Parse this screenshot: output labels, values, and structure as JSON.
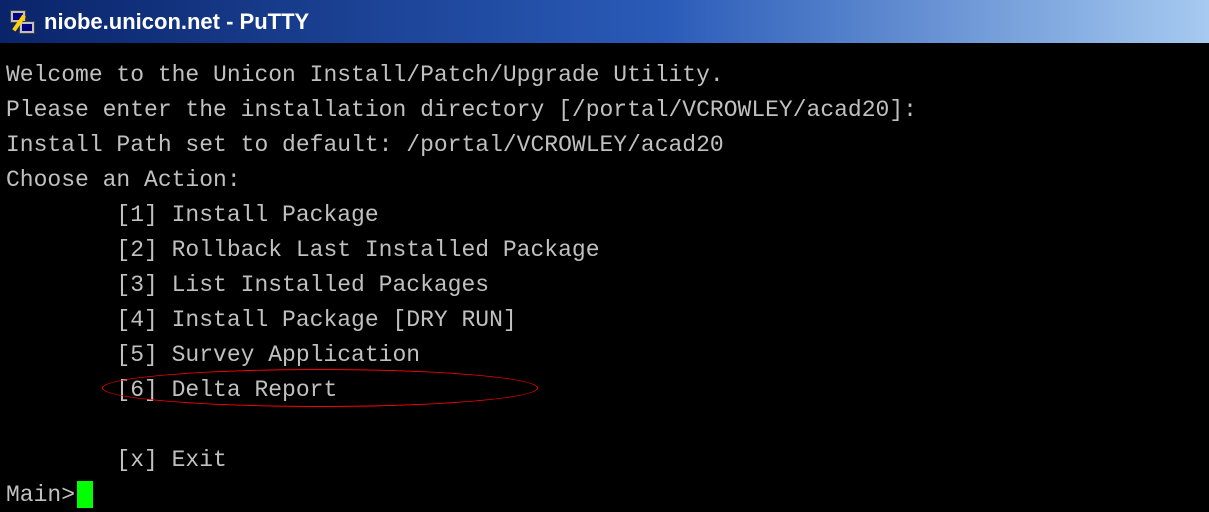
{
  "window": {
    "title": "niobe.unicon.net - PuTTY"
  },
  "terminal": {
    "lines": [
      "Welcome to the Unicon Install/Patch/Upgrade Utility.",
      "Please enter the installation directory [/portal/VCROWLEY/acad20]:",
      "Install Path set to default: /portal/VCROWLEY/acad20",
      "Choose an Action:",
      "        [1] Install Package",
      "        [2] Rollback Last Installed Package",
      "        [3] List Installed Packages",
      "        [4] Install Package [DRY RUN]",
      "        [5] Survey Application",
      "        [6] Delta Report",
      "",
      "        [x] Exit"
    ],
    "prompt": "Main>"
  },
  "colors": {
    "background": "#000000",
    "text": "#c0c0c0",
    "cursor": "#00ff00",
    "annotation": "#ff0000",
    "titlebar_start": "#0a246a",
    "titlebar_end": "#a6caf0"
  }
}
